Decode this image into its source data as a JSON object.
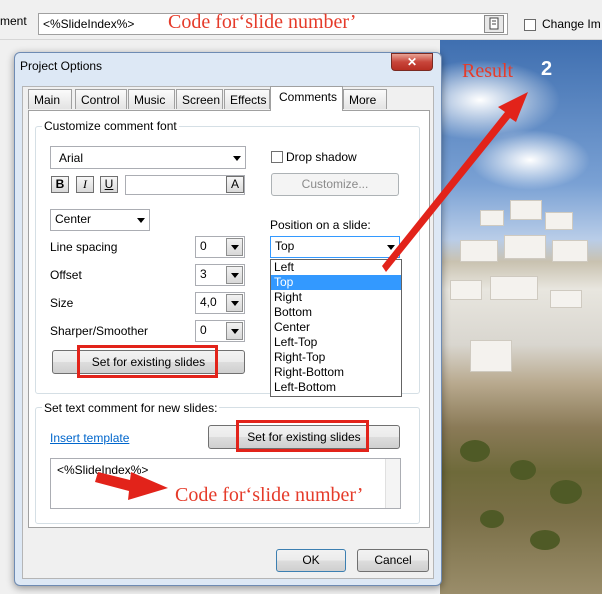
{
  "topbar": {
    "label": "ment",
    "input_value": "<%SlideIndex%>",
    "annotation": "Code for‘slide number’",
    "change_label": "Change Im"
  },
  "dialog": {
    "title": "Project Options",
    "close_glyph": "✕",
    "tabs": [
      "Main",
      "Control",
      "Music",
      "Screen",
      "Effects",
      "Comments",
      "More"
    ],
    "active_tab": "Comments",
    "font_group": {
      "title": "Customize comment font",
      "font_name": "Arial",
      "bold": "B",
      "italic": "I",
      "underline": "U",
      "color_letter": "A",
      "drop_shadow_label": "Drop shadow",
      "customize_label": "Customize...",
      "alignment": "Center",
      "position_label": "Position on a slide:",
      "position_value": "Top",
      "position_options": [
        "Left",
        "Top",
        "Right",
        "Bottom",
        "Center",
        "Left-Top",
        "Right-Top",
        "Right-Bottom",
        "Left-Bottom"
      ],
      "rows": [
        {
          "label": "Line spacing",
          "value": "0"
        },
        {
          "label": "Offset",
          "value": "3"
        },
        {
          "label": "Size",
          "value": "4,0"
        },
        {
          "label": "Sharper/Smoother",
          "value": "0"
        }
      ],
      "set_existing_label": "Set for existing slides"
    },
    "text_group": {
      "title": "Set text comment for new slides:",
      "insert_template": "Insert template",
      "set_existing_label": "Set for existing slides",
      "textarea_value": "<%SlideIndex%>",
      "annotation": "Code for‘slide number’"
    },
    "ok_label": "OK",
    "cancel_label": "Cancel"
  },
  "annotations": {
    "result_label": "Result",
    "result_value": "2",
    "color": "#e2231a"
  }
}
